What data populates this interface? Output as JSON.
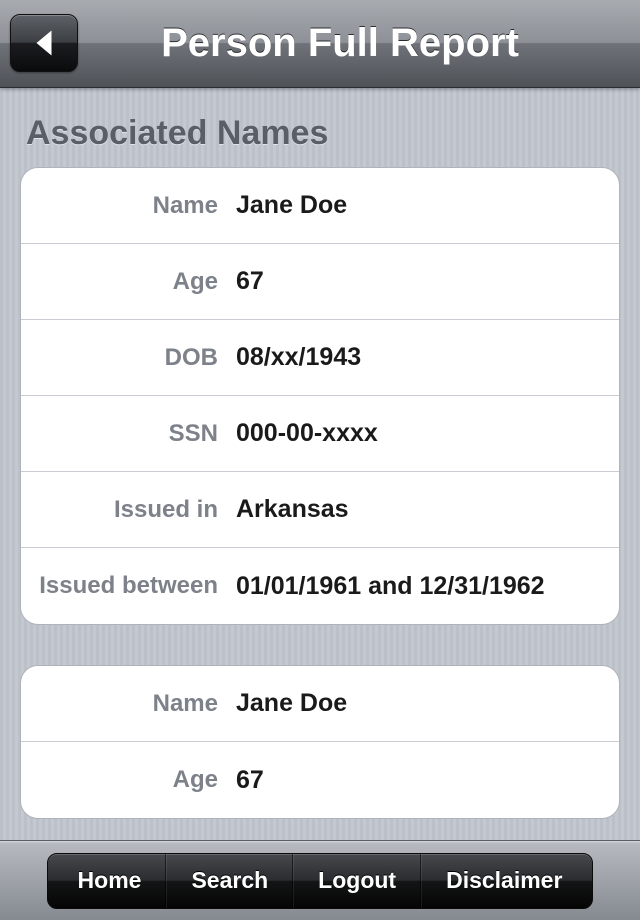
{
  "header": {
    "title": "Person Full Report"
  },
  "section": {
    "title": "Associated Names"
  },
  "labels": {
    "name": "Name",
    "age": "Age",
    "dob": "DOB",
    "ssn": "SSN",
    "issued_in": "Issued in",
    "issued_between": "Issued between"
  },
  "records": [
    {
      "name": "Jane Doe",
      "age": "67",
      "dob": "08/xx/1943",
      "ssn": "000-00-xxxx",
      "issued_in": "Arkansas",
      "issued_between": "01/01/1961 and 12/31/1962"
    },
    {
      "name": "Jane Doe",
      "age": "67"
    }
  ],
  "toolbar": {
    "home": "Home",
    "search": "Search",
    "logout": "Logout",
    "disclaimer": "Disclaimer"
  }
}
